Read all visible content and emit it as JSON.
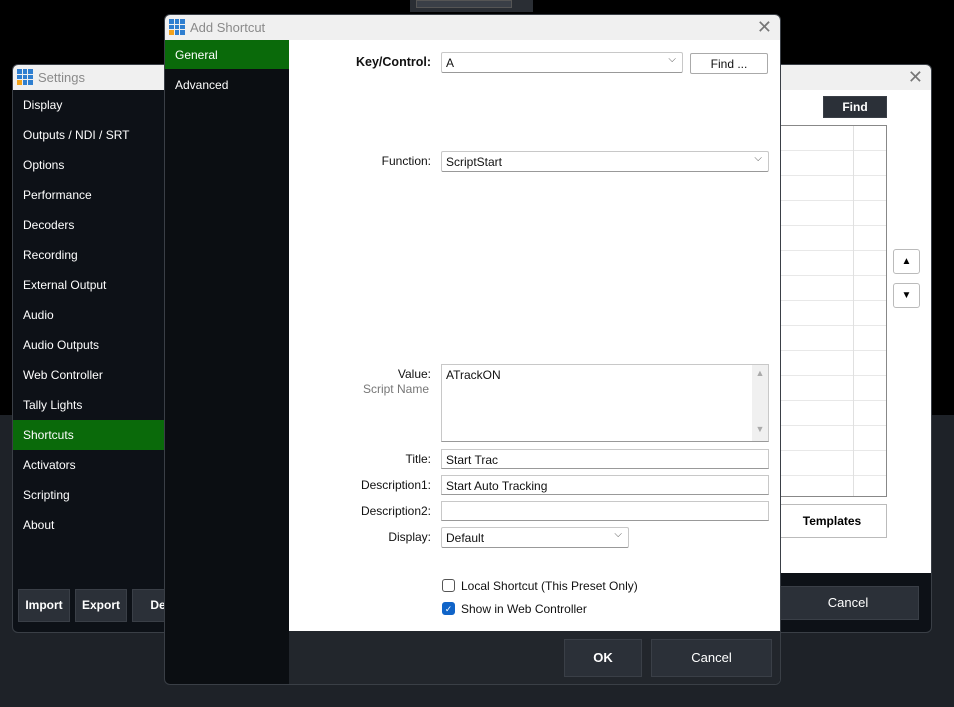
{
  "settings": {
    "title": "Settings",
    "nav": [
      "Display",
      "Outputs / NDI / SRT",
      "Options",
      "Performance",
      "Decoders",
      "Recording",
      "External Output",
      "Audio",
      "Audio Outputs",
      "Web Controller",
      "Tally Lights",
      "Shortcuts",
      "Activators",
      "Scripting",
      "About"
    ],
    "selected": "Shortcuts",
    "find_label": "Find",
    "templates_label": "Templates",
    "import_label": "Import",
    "export_label": "Export",
    "partial_label": "De",
    "cancel_label": "Cancel"
  },
  "dialog": {
    "title": "Add Shortcut",
    "tabs": [
      "General",
      "Advanced"
    ],
    "selected_tab": "General",
    "key_label": "Key/Control:",
    "key_value": "A",
    "find_label": "Find ...",
    "function_label": "Function:",
    "function_value": "ScriptStart",
    "value_label": "Value:",
    "value_hint": "Script Name",
    "value_text": "ATrackON",
    "title_label": "Title:",
    "title_value": "Start Trac",
    "desc1_label": "Description1:",
    "desc1_value": "Start Auto Tracking",
    "desc2_label": "Description2:",
    "desc2_value": "",
    "display_label": "Display:",
    "display_value": "Default",
    "local_label": "Local Shortcut (This Preset Only)",
    "local_checked": false,
    "web_label": "Show in Web Controller",
    "web_checked": true,
    "ok_label": "OK",
    "cancel_label": "Cancel"
  },
  "colors": {
    "accent_green": "#0a6a0a",
    "checkbox_blue": "#1064c8"
  }
}
